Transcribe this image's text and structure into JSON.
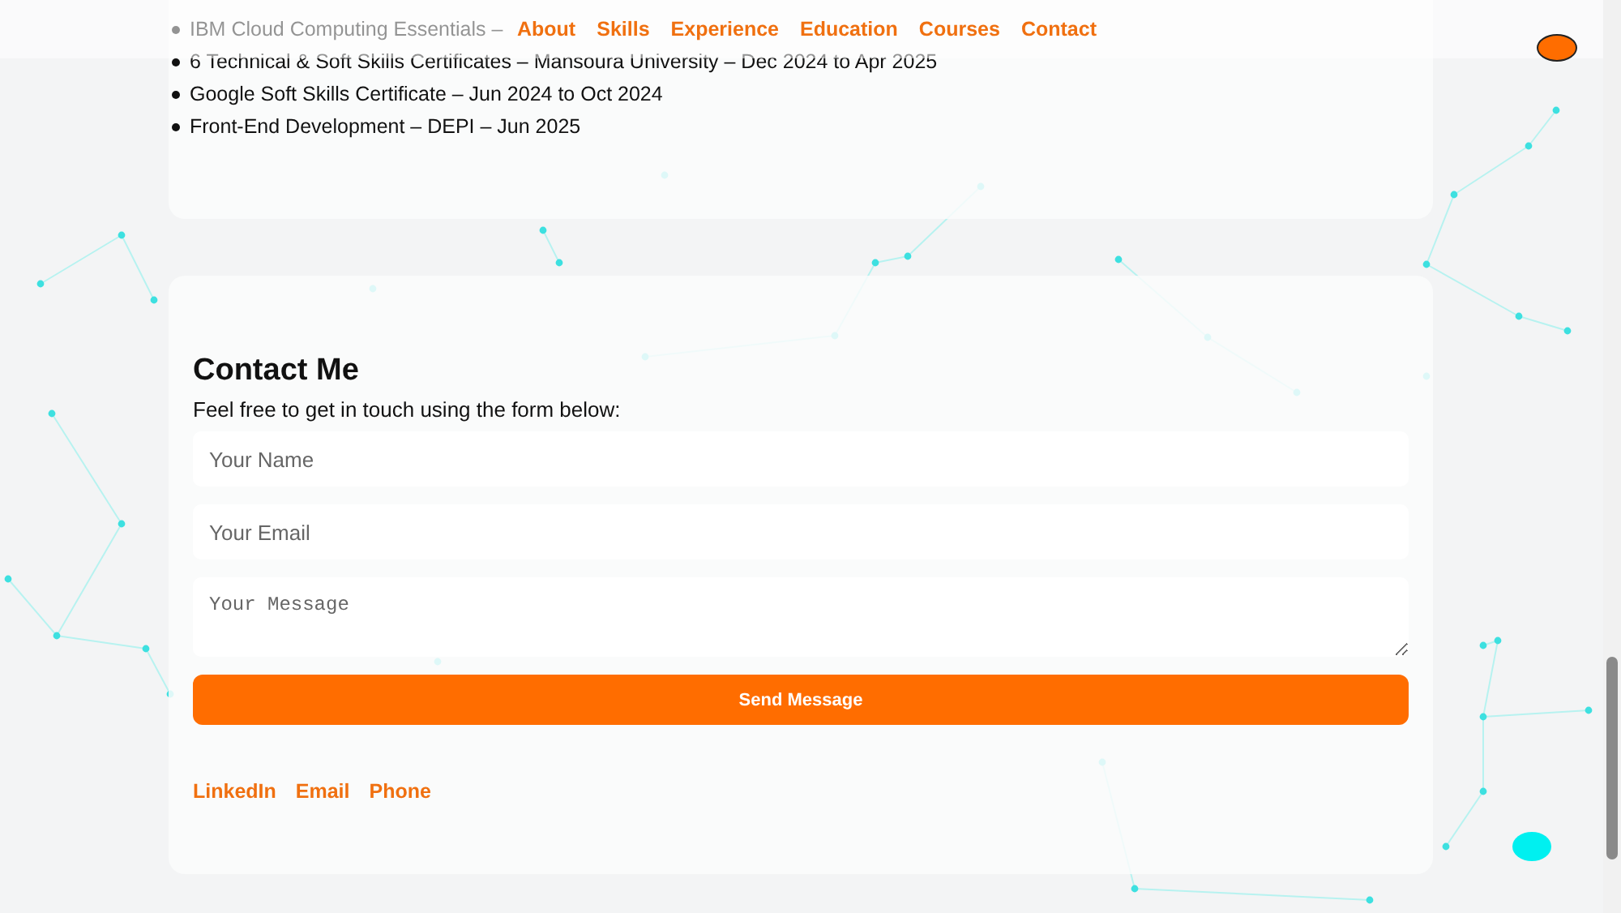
{
  "nav": {
    "links": [
      "About",
      "Skills",
      "Experience",
      "Education",
      "Courses",
      "Contact"
    ]
  },
  "certificates": [
    "IBM Cloud Computing Essentials –",
    "6 Technical & Soft Skills Certificates – Mansoura University – Dec 2024 to Apr 2025",
    "Google Soft Skills Certificate – Jun 2024 to Oct 2024",
    "Front-End Development – DEPI – Jun 2025"
  ],
  "contact": {
    "title": "Contact Me",
    "intro": "Feel free to get in touch using the form below:",
    "fields": [
      {
        "kind": "input",
        "placeholder": "Your Name"
      },
      {
        "kind": "input",
        "placeholder": "Your Email"
      },
      {
        "kind": "textarea",
        "placeholder": "Your Message"
      }
    ],
    "submit": "Send Message",
    "links": [
      "LinkedIn",
      "Email",
      "Phone"
    ]
  },
  "theme_toggle": {
    "on": false
  }
}
